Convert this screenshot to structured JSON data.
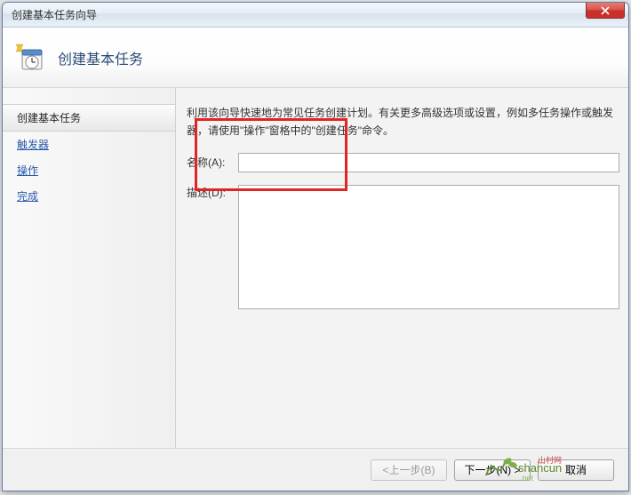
{
  "window": {
    "title": "创建基本任务向导"
  },
  "header": {
    "title": "创建基本任务"
  },
  "sidebar": {
    "items": [
      {
        "label": "创建基本任务",
        "active": true
      },
      {
        "label": "触发器",
        "active": false
      },
      {
        "label": "操作",
        "active": false
      },
      {
        "label": "完成",
        "active": false
      }
    ]
  },
  "content": {
    "description": "利用该向导快速地为常见任务创建计划。有关更多高级选项或设置，例如多任务操作或触发器，请使用\"操作\"窗格中的\"创建任务\"命令。",
    "name_label": "名称(A):",
    "name_value": "",
    "desc_label": "描述(D):",
    "desc_value": ""
  },
  "footer": {
    "back": "<上一步(B)",
    "next": "下一步(N) >",
    "cancel": "取消"
  },
  "watermark": {
    "text": "shancun",
    "suffix": ".net",
    "cn": "山村网"
  }
}
